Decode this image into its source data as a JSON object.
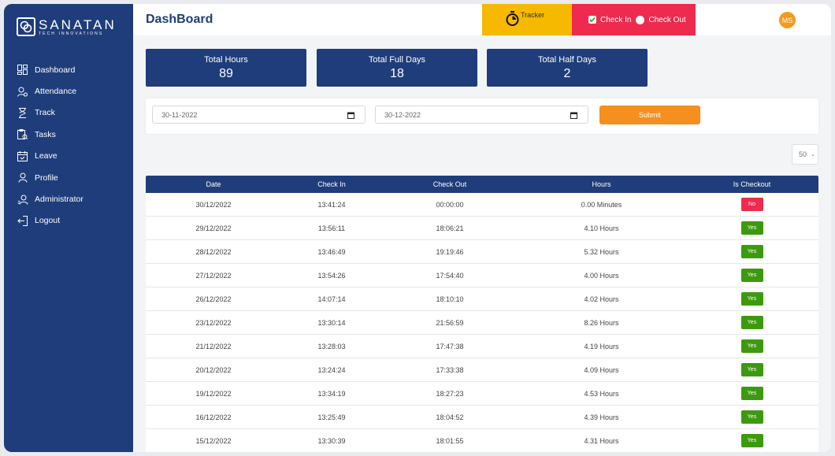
{
  "brand": {
    "name": "SANATAN",
    "tagline": "TECH INNOVATIONS"
  },
  "sidebar": {
    "items": [
      {
        "label": "Dashboard",
        "icon": "dashboard-icon"
      },
      {
        "label": "Attendance",
        "icon": "attendance-icon"
      },
      {
        "label": "Track",
        "icon": "hourglass-icon"
      },
      {
        "label": "Tasks",
        "icon": "tasks-icon"
      },
      {
        "label": "Leave",
        "icon": "calendar-icon"
      },
      {
        "label": "Profile",
        "icon": "user-icon"
      },
      {
        "label": "Administrator",
        "icon": "admin-icon"
      },
      {
        "label": "Logout",
        "icon": "logout-icon"
      }
    ]
  },
  "header": {
    "title": "DashBoard",
    "tracker_label": "Tracker",
    "check_in_label": "Check In",
    "check_out_label": "Check Out",
    "avatar_initials": "MS"
  },
  "stats": [
    {
      "label": "Total Hours",
      "value": "89"
    },
    {
      "label": "Total Full Days",
      "value": "18"
    },
    {
      "label": "Total Half Days",
      "value": "2"
    }
  ],
  "filter": {
    "from_date": "30-11-2022",
    "to_date": "30-12-2022",
    "submit_label": "Submit"
  },
  "page_size": "50",
  "table": {
    "columns": [
      "Date",
      "Check In",
      "Check Out",
      "Hours",
      "Is Checkout"
    ],
    "rows": [
      {
        "date": "30/12/2022",
        "check_in": "13:41:24",
        "check_out": "00:00:00",
        "hours": "0.00 Minutes",
        "is_checkout": "No"
      },
      {
        "date": "29/12/2022",
        "check_in": "13:56:11",
        "check_out": "18:06:21",
        "hours": "4.10 Hours",
        "is_checkout": "Yes"
      },
      {
        "date": "28/12/2022",
        "check_in": "13:46:49",
        "check_out": "19:19:46",
        "hours": "5.32 Hours",
        "is_checkout": "Yes"
      },
      {
        "date": "27/12/2022",
        "check_in": "13:54:26",
        "check_out": "17:54:40",
        "hours": "4.00 Hours",
        "is_checkout": "Yes"
      },
      {
        "date": "26/12/2022",
        "check_in": "14:07:14",
        "check_out": "18:10:10",
        "hours": "4.02 Hours",
        "is_checkout": "Yes"
      },
      {
        "date": "23/12/2022",
        "check_in": "13:30:14",
        "check_out": "21:56:59",
        "hours": "8.26 Hours",
        "is_checkout": "Yes"
      },
      {
        "date": "21/12/2022",
        "check_in": "13:28:03",
        "check_out": "17:47:38",
        "hours": "4.19 Hours",
        "is_checkout": "Yes"
      },
      {
        "date": "20/12/2022",
        "check_in": "13:24:24",
        "check_out": "17:33:38",
        "hours": "4.09 Hours",
        "is_checkout": "Yes"
      },
      {
        "date": "19/12/2022",
        "check_in": "13:34:19",
        "check_out": "18:27:23",
        "hours": "4.53 Hours",
        "is_checkout": "Yes"
      },
      {
        "date": "16/12/2022",
        "check_in": "13:25:49",
        "check_out": "18:04:52",
        "hours": "4.39 Hours",
        "is_checkout": "Yes"
      },
      {
        "date": "15/12/2022",
        "check_in": "13:30:39",
        "check_out": "18:01:55",
        "hours": "4.31 Hours",
        "is_checkout": "Yes"
      }
    ]
  },
  "colors": {
    "primary": "#1f3d7a",
    "tracker": "#f7b800",
    "checkin": "#ee2a4e",
    "accent": "#f58f1e",
    "yes": "#3d9a0e",
    "no": "#ee2a4e"
  }
}
